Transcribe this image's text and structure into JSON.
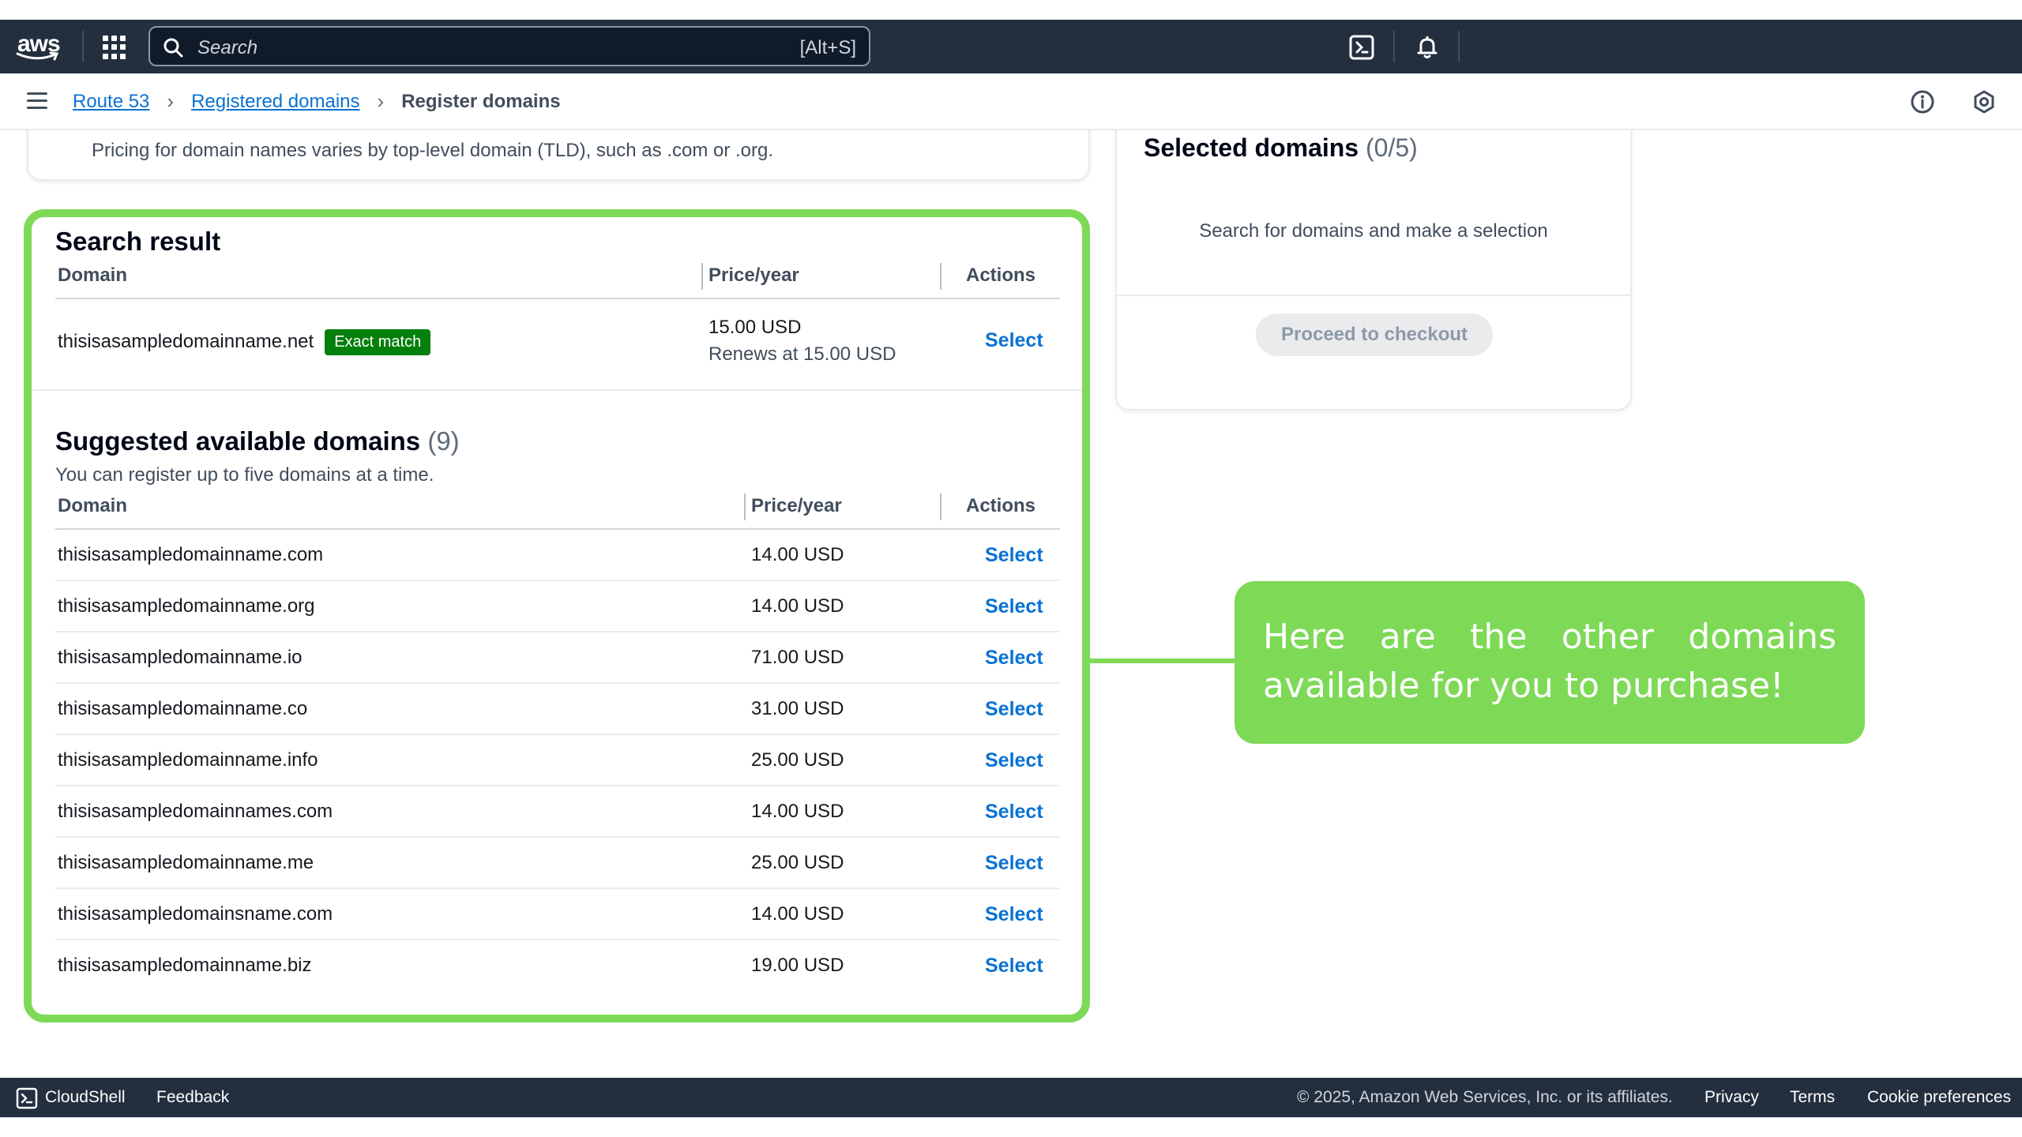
{
  "nav": {
    "logo": "aws",
    "search_placeholder": "Search",
    "search_shortcut": "[Alt+S]"
  },
  "breadcrumb": {
    "items": [
      "Route 53",
      "Registered domains"
    ],
    "current": "Register domains"
  },
  "pricing": {
    "text": "Pricing for domain names varies by top-level domain (TLD), such as .com or .org."
  },
  "selected": {
    "title": "Selected domains",
    "count": "(0/5)",
    "empty_text": "Search for domains and make a selection",
    "checkout_label": "Proceed to checkout"
  },
  "search_result": {
    "title": "Search result",
    "headers": {
      "domain": "Domain",
      "price": "Price/year",
      "actions": "Actions"
    },
    "domain": "thisisasampledomainname.net",
    "badge": "Exact match",
    "price": "15.00 USD",
    "renews": "Renews at 15.00 USD",
    "action": "Select"
  },
  "suggested": {
    "title": "Suggested available domains",
    "count": "(9)",
    "subtitle": "You can register up to five domains at a time.",
    "headers": {
      "domain": "Domain",
      "price": "Price/year",
      "actions": "Actions"
    },
    "rows": [
      {
        "domain": "thisisasampledomainname.com",
        "price": "14.00 USD",
        "action": "Select"
      },
      {
        "domain": "thisisasampledomainname.org",
        "price": "14.00 USD",
        "action": "Select"
      },
      {
        "domain": "thisisasampledomainname.io",
        "price": "71.00 USD",
        "action": "Select"
      },
      {
        "domain": "thisisasampledomainname.co",
        "price": "31.00 USD",
        "action": "Select"
      },
      {
        "domain": "thisisasampledomainname.info",
        "price": "25.00 USD",
        "action": "Select"
      },
      {
        "domain": "thisisasampledomainnames.com",
        "price": "14.00 USD",
        "action": "Select"
      },
      {
        "domain": "thisisasampledomainname.me",
        "price": "25.00 USD",
        "action": "Select"
      },
      {
        "domain": "thisisasampledomainsname.com",
        "price": "14.00 USD",
        "action": "Select"
      },
      {
        "domain": "thisisasampledomainname.biz",
        "price": "19.00 USD",
        "action": "Select"
      }
    ]
  },
  "callout": {
    "text": "Here are the other domains available for you to purchase!"
  },
  "footer": {
    "cloudshell": "CloudShell",
    "feedback": "Feedback",
    "copyright": "© 2025, Amazon Web Services, Inc. or its affiliates.",
    "privacy": "Privacy",
    "terms": "Terms",
    "cookies": "Cookie preferences"
  },
  "colors": {
    "nav_bg": "#232f3e",
    "link": "#0972d3",
    "highlight": "#7ed957",
    "badge": "#037f0c"
  }
}
